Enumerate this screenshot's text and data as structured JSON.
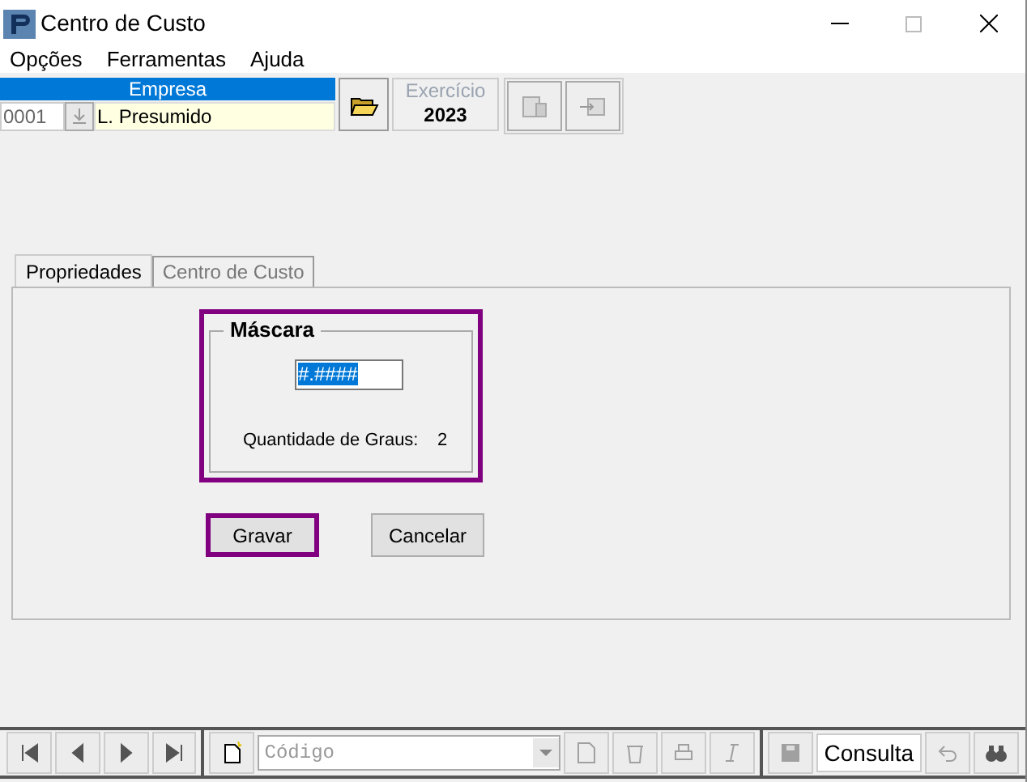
{
  "window": {
    "title": "Centro de Custo"
  },
  "menu": [
    "Opções",
    "Ferramentas",
    "Ajuda"
  ],
  "empresa": {
    "label": "Empresa",
    "code": "0001",
    "name": "L. Presumido"
  },
  "exercicio": {
    "label": "Exercício",
    "year": "2023"
  },
  "tabs": [
    {
      "label": "Propriedades",
      "selected": true
    },
    {
      "label": "Centro de Custo",
      "selected": false
    }
  ],
  "mascara": {
    "title": "Máscara",
    "value": "#.####",
    "text_selected": true,
    "highlighted": true,
    "graus_label": "Quantidade de Graus:",
    "graus_value": "2"
  },
  "buttons": [
    {
      "label": "Gravar",
      "highlighted": true
    },
    {
      "label": "Cancelar",
      "highlighted": false
    }
  ],
  "bottom_toolbar": [
    {
      "kind": "first",
      "disabled": false
    },
    {
      "kind": "prev",
      "disabled": false
    },
    {
      "kind": "next",
      "disabled": false
    },
    {
      "kind": "last",
      "disabled": false
    },
    {
      "kind": "sep"
    },
    {
      "kind": "new",
      "disabled": false
    },
    {
      "kind": "combo",
      "placeholder": "Código"
    },
    {
      "kind": "report",
      "disabled": true
    },
    {
      "kind": "delete",
      "disabled": true
    },
    {
      "kind": "print",
      "disabled": true
    },
    {
      "kind": "italic",
      "disabled": true
    },
    {
      "kind": "sep"
    },
    {
      "kind": "save",
      "disabled": true
    },
    {
      "kind": "mode",
      "text": "Consulta"
    },
    {
      "kind": "undo",
      "disabled": true
    },
    {
      "kind": "find",
      "disabled": false
    }
  ]
}
